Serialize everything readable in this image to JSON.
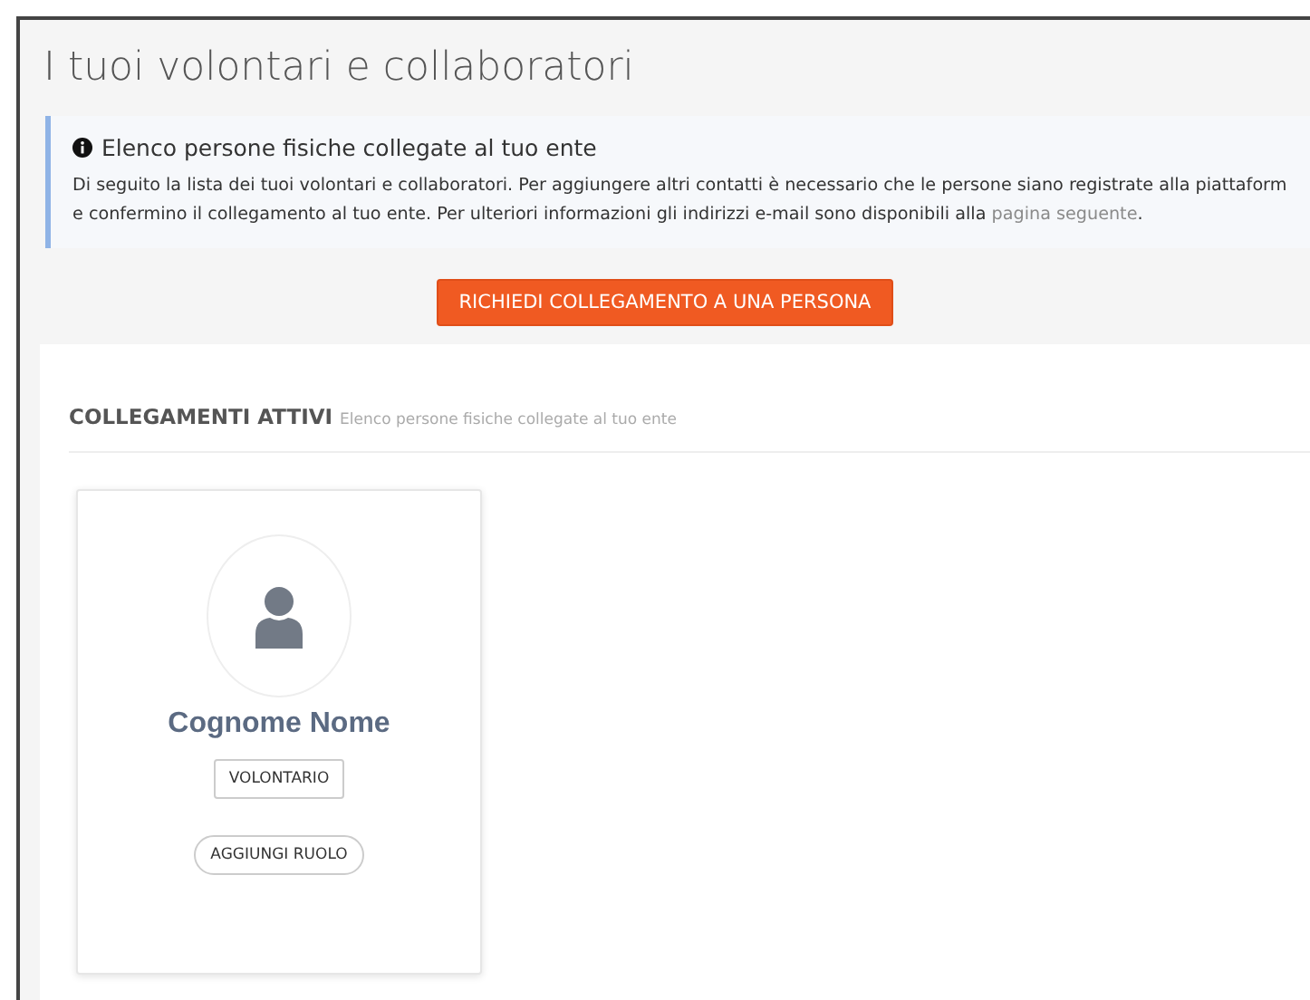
{
  "page_title": "I tuoi volontari e collaboratori",
  "info": {
    "heading": "Elenco persone fisiche collegate al tuo ente",
    "text": "Di seguito la lista dei tuoi volontari e collaboratori. Per aggiungere altri contatti è necessario che le persone siano registrate alla piattaform\ne confermino il collegamento al tuo ente. Per ulteriori informazioni gli indirizzi e-mail sono disponibili alla ",
    "link": "pagina seguente",
    "text_end": "."
  },
  "request_button": "RICHIEDI COLLEGAMENTO A UNA PERSONA",
  "section": {
    "title": "COLLEGAMENTI ATTIVI",
    "subtitle": "Elenco persone fisiche collegate al tuo ente"
  },
  "people": [
    {
      "name": "Cognome Nome",
      "roles": [
        "VOLONTARIO"
      ],
      "add_role": "AGGIUNGI RUOLO"
    }
  ]
}
